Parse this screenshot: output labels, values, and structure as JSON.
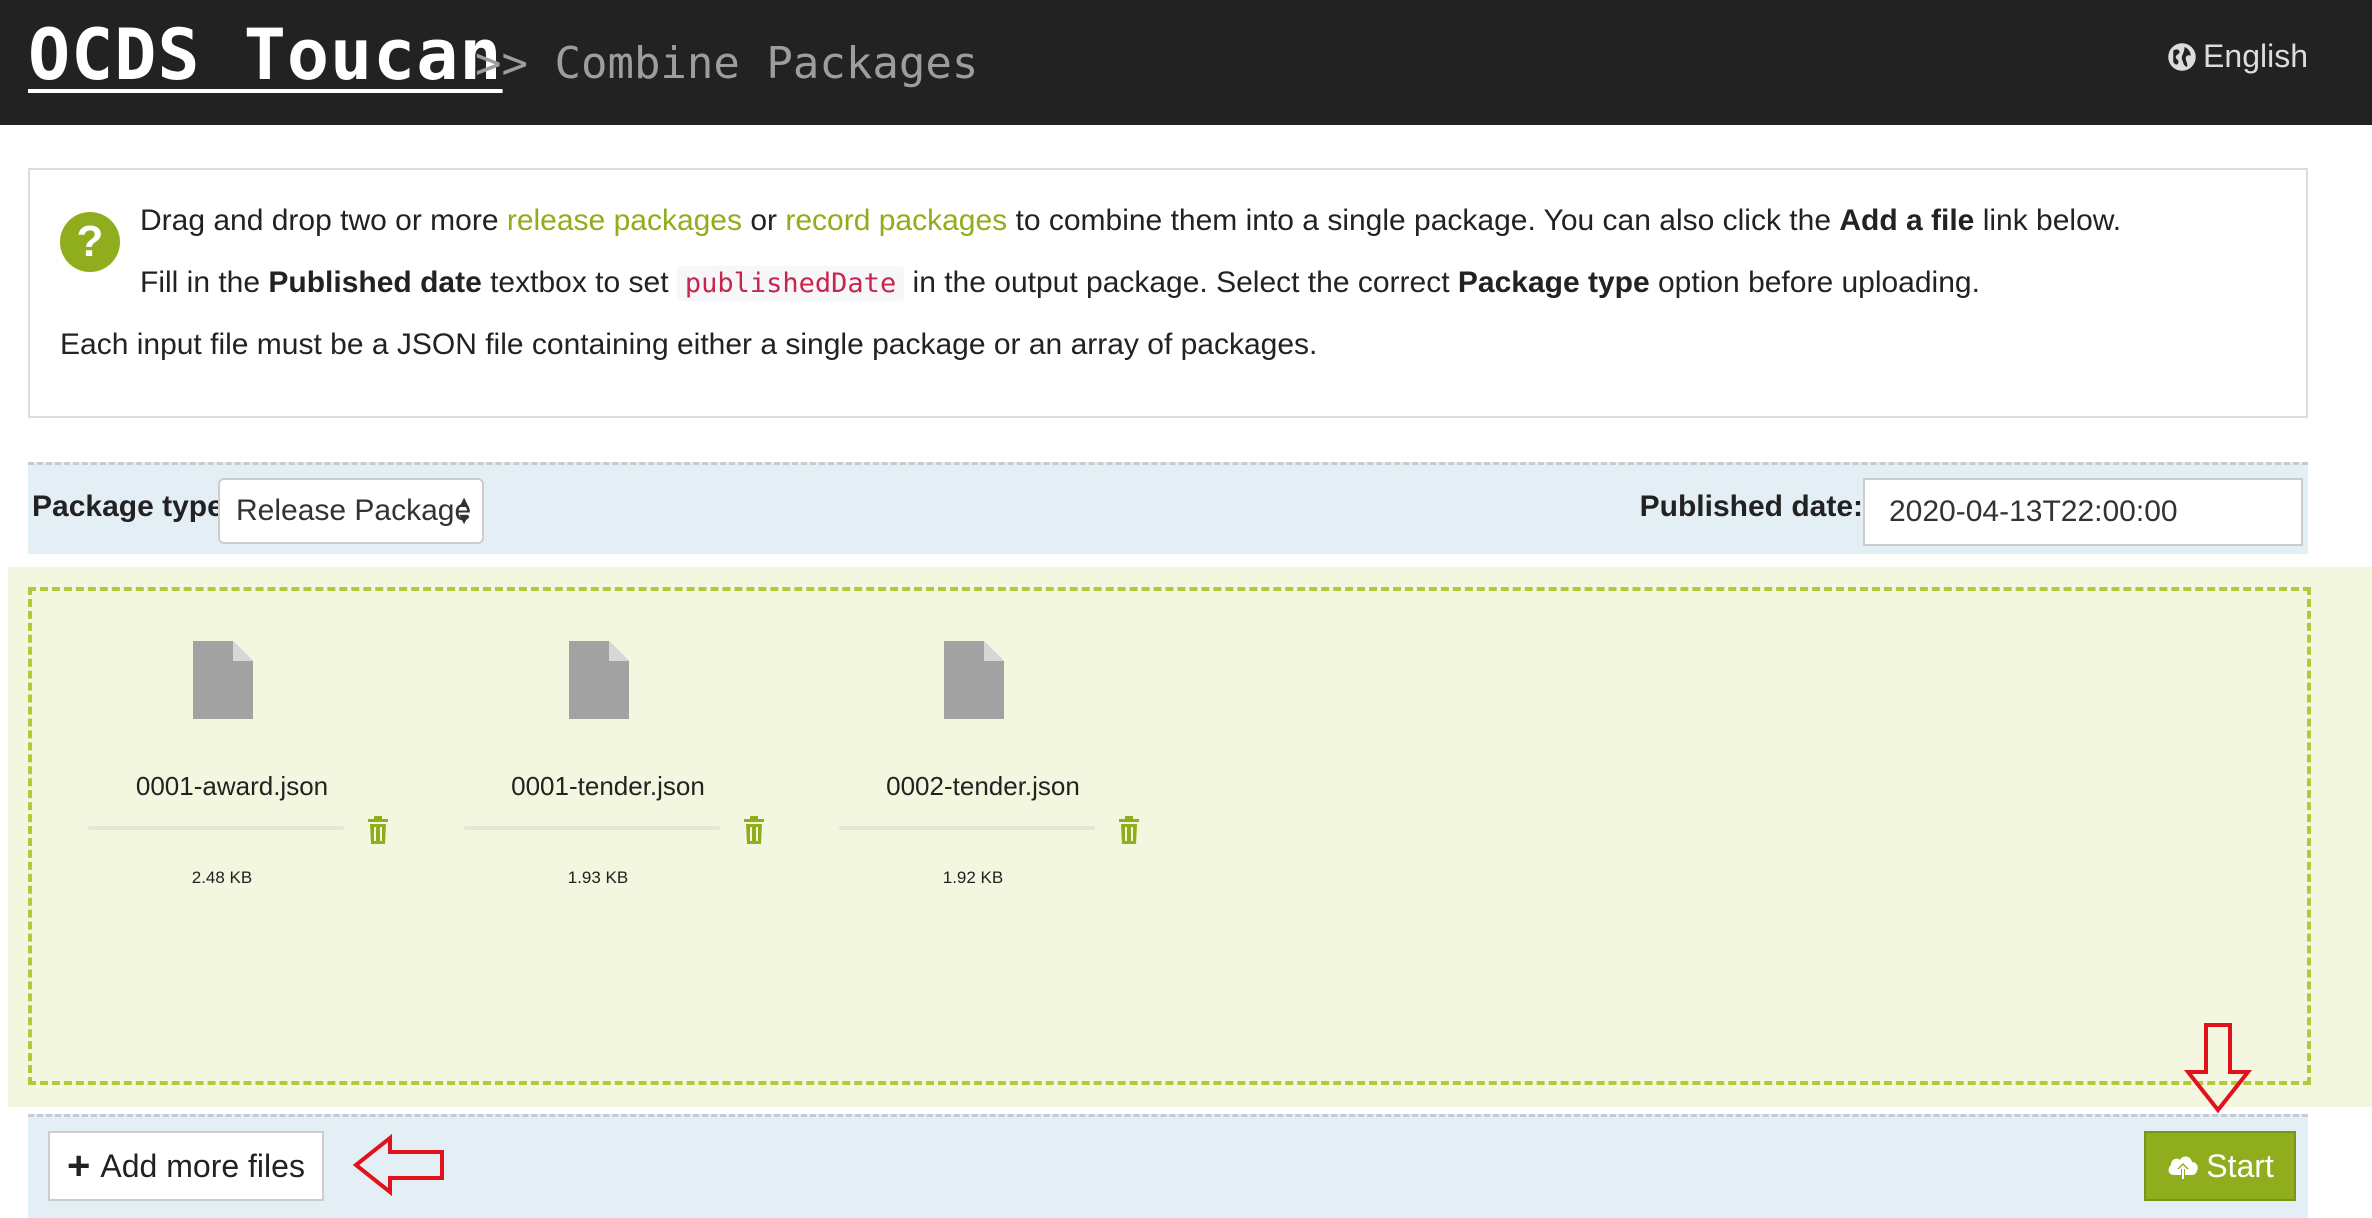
{
  "header": {
    "brand": "OCDS Toucan",
    "subtitle": ">> Combine Packages",
    "language": "English",
    "language_icon": "globe-icon"
  },
  "info": {
    "icon": "question-circle-icon",
    "line1": {
      "pre": "Drag and drop two or more ",
      "link1": "release packages",
      "mid": " or ",
      "link2": "record packages",
      "post": " to combine them into a single package. You can also click the ",
      "bold": "Add a file",
      "end": " link below."
    },
    "line2": {
      "pre": "Fill in the ",
      "bold1": "Published date",
      "mid1": " textbox to set ",
      "code": "publishedDate",
      "mid2": " in the output package. Select the correct ",
      "bold2": "Package type",
      "end": " option before uploading."
    },
    "line3": "Each input file must be a JSON file containing either a single package or an array of packages."
  },
  "options": {
    "package_type_label": "Package type:",
    "package_type_value": "Release Package",
    "published_date_label": "Published date:",
    "published_date_value": "2020-04-13T22:00:00"
  },
  "files": [
    {
      "name": "0001-award.json",
      "size": "2.48 KB"
    },
    {
      "name": "0001-tender.json",
      "size": "1.93 KB"
    },
    {
      "name": "0002-tender.json",
      "size": "1.92 KB"
    }
  ],
  "actions": {
    "add_label": "Add more files",
    "start_label": "Start"
  },
  "colors": {
    "accent": "#8fad1c",
    "header_bg": "#222222",
    "bar_bg": "#e3eff5",
    "dropzone_bg": "#f4f7e0",
    "annotation_arrow": "#e0121b"
  }
}
